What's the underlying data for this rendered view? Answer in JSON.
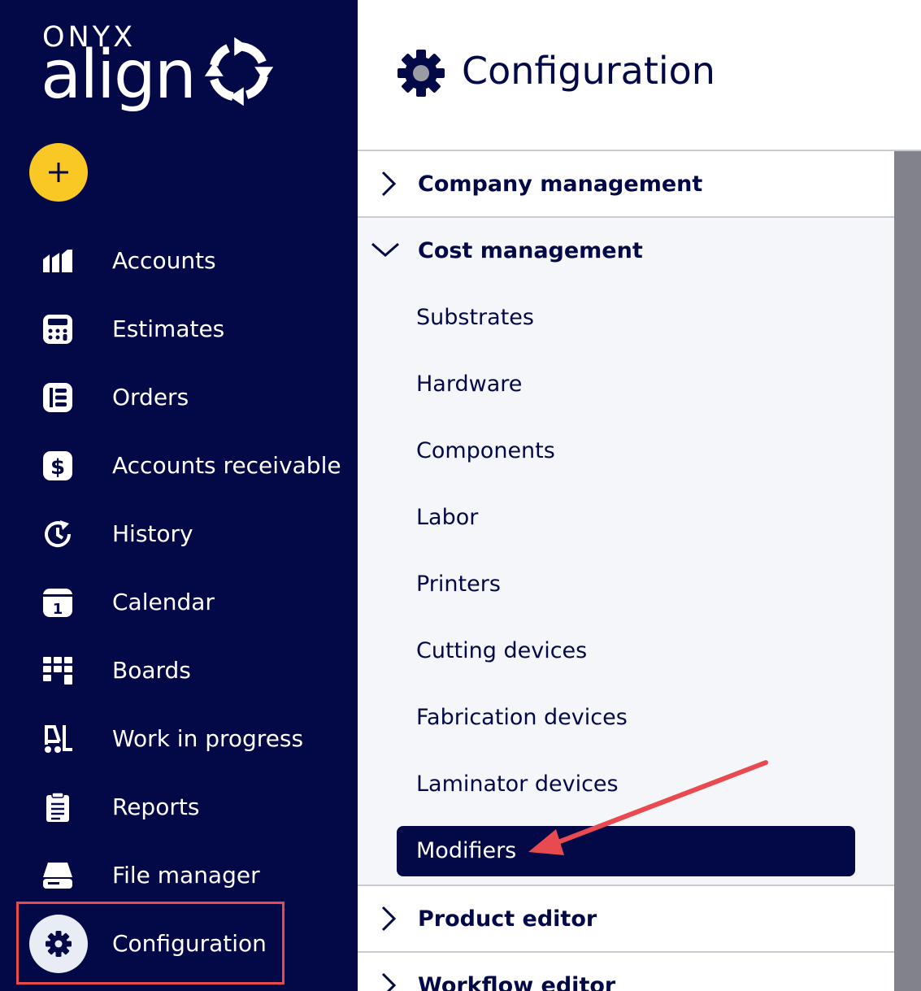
{
  "brand": {
    "company": "ONYX",
    "product": "align"
  },
  "sidebar": {
    "new_button_icon": "plus-icon",
    "items": [
      {
        "label": "Accounts",
        "icon": "accounts-icon"
      },
      {
        "label": "Estimates",
        "icon": "calculator-icon"
      },
      {
        "label": "Orders",
        "icon": "orders-icon"
      },
      {
        "label": "Accounts receivable",
        "icon": "dollar-icon"
      },
      {
        "label": "History",
        "icon": "history-icon"
      },
      {
        "label": "Calendar",
        "icon": "calendar-icon"
      },
      {
        "label": "Boards",
        "icon": "boards-icon"
      },
      {
        "label": "Work in progress",
        "icon": "forklift-icon"
      },
      {
        "label": "Reports",
        "icon": "clipboard-icon"
      },
      {
        "label": "File manager",
        "icon": "drive-icon"
      },
      {
        "label": "Configuration",
        "icon": "gear-icon",
        "selected": true
      }
    ]
  },
  "header": {
    "title": "Configuration",
    "icon": "gear-icon"
  },
  "config_panel": {
    "sections": [
      {
        "label": "Company management",
        "expanded": false
      },
      {
        "label": "Cost management",
        "expanded": true,
        "items": [
          "Substrates",
          "Hardware",
          "Components",
          "Labor",
          "Printers",
          "Cutting devices",
          "Fabrication devices",
          "Laminator devices",
          "Modifiers"
        ],
        "active_item": "Modifiers"
      },
      {
        "label": "Product editor",
        "expanded": false
      },
      {
        "label": "Workflow editor",
        "expanded": false
      }
    ]
  },
  "colors": {
    "navy": "#030947",
    "accent_yellow": "#f9c825",
    "annotation_red": "#e94a4f",
    "panel_bg": "#f4f6f9"
  }
}
